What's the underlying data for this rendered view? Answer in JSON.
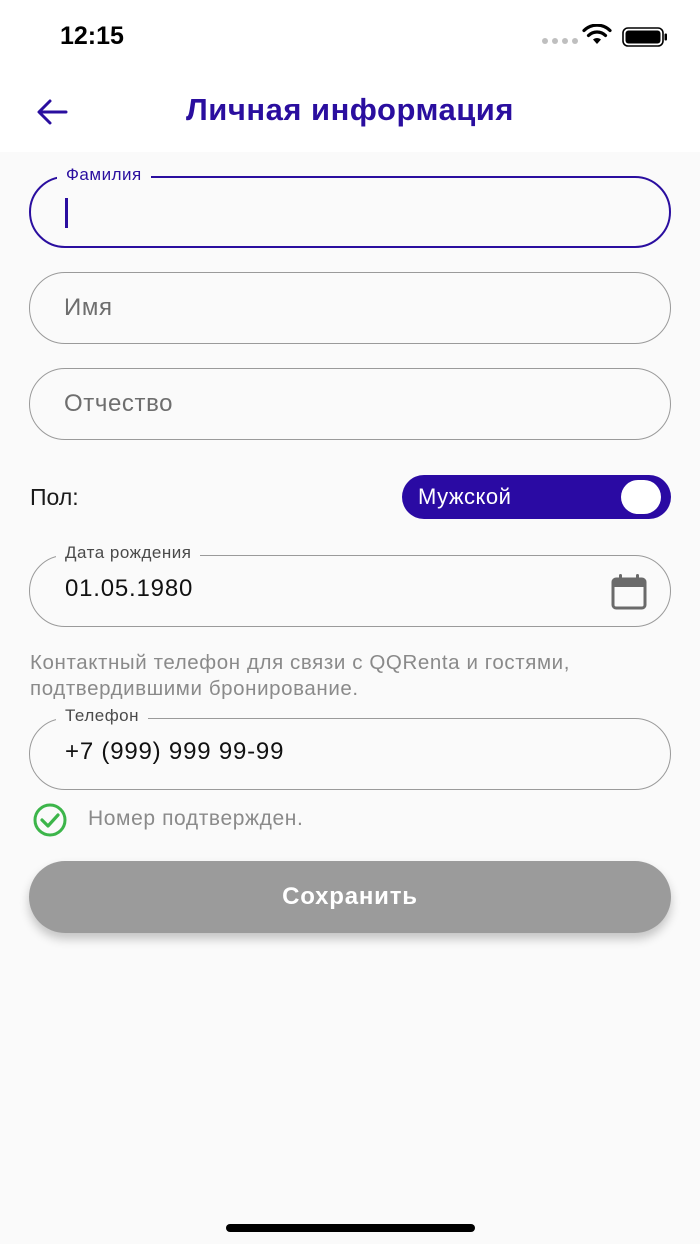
{
  "status_bar": {
    "time": "12:15"
  },
  "header": {
    "title": "Личная информация"
  },
  "form": {
    "last_name": {
      "label": "Фамилия",
      "value": ""
    },
    "first_name": {
      "placeholder": "Имя"
    },
    "patronymic": {
      "placeholder": "Отчество"
    },
    "gender": {
      "label": "Пол:",
      "value": "Мужской"
    },
    "birth_date": {
      "label": "Дата рождения",
      "value": "01.05.1980"
    },
    "phone_helper": "Контактный телефон для связи с QQRenta и гостями, подтвердившими бронирование.",
    "phone": {
      "label": "Телефон",
      "value": "+7 (999) 999 99-99"
    },
    "verified_text": "Номер подтвержден.",
    "save_label": "Сохранить"
  },
  "colors": {
    "accent": "#2a0e9f",
    "toggle": "#2a0aa3",
    "verified": "#3cb54a",
    "disabled_button": "#9b9b9b"
  },
  "icons": [
    "back-arrow-icon",
    "calendar-icon",
    "check-circle-icon",
    "wifi-icon",
    "battery-icon"
  ]
}
